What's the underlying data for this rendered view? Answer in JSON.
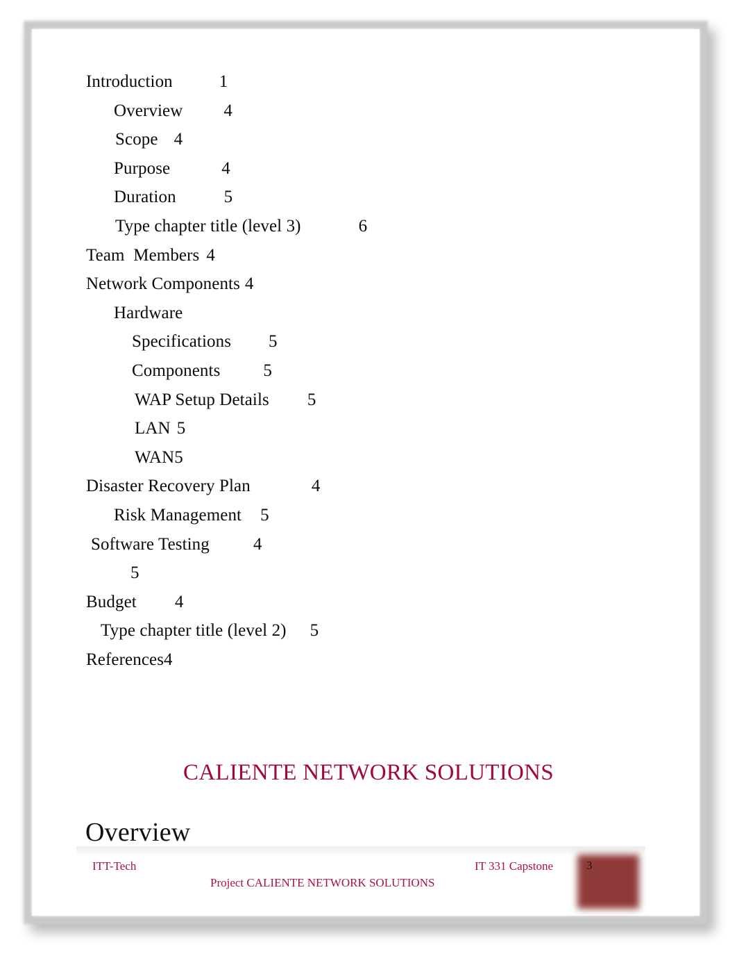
{
  "document": {
    "title": "CALIENTE NETWORK SOLUTIONS",
    "section_heading": "Overview"
  },
  "toc": {
    "entries": [
      {
        "title": "Introduction",
        "page": "1",
        "level": 0
      },
      {
        "title": "Overview",
        "page": "4",
        "level": 1
      },
      {
        "title": "Scope",
        "page": "4",
        "level": 1
      },
      {
        "title": "Purpose",
        "page": "4",
        "level": 1
      },
      {
        "title": "Duration",
        "page": "5",
        "level": 1
      },
      {
        "title": "Type chapter title (level 3)",
        "page": "6",
        "level": 1
      },
      {
        "title": "Team  Members",
        "page": "4",
        "level": 0
      },
      {
        "title": "Network Components",
        "page": "4",
        "level": 0
      },
      {
        "title": "Hardware",
        "page": "",
        "level": 1
      },
      {
        "title": "Specifications",
        "page": "5",
        "level": 2
      },
      {
        "title": "Components",
        "page": "5",
        "level": 2
      },
      {
        "title": "WAP Setup Details",
        "page": "5",
        "level": 2
      },
      {
        "title": "LAN",
        "page": "5",
        "level": 2
      },
      {
        "title": "WAN",
        "page": "5",
        "level": 2
      },
      {
        "title": "Disaster Recovery Plan",
        "page": "4",
        "level": 0
      },
      {
        "title": "Risk Management",
        "page": "5",
        "level": 1
      },
      {
        "title": "Software Testing",
        "page": "4",
        "level": 0
      },
      {
        "title": "",
        "page": "5",
        "level": 2
      },
      {
        "title": "Budget",
        "page": "4",
        "level": 0
      },
      {
        "title": "Type chapter title (level 2)",
        "page": "5",
        "level": 1
      },
      {
        "title": "References",
        "page": "4",
        "level": 0
      }
    ]
  },
  "footer": {
    "left": "ITT-Tech",
    "right": "IT 331 Capstone",
    "center": "Project CALIENTE NETWORK SOLUTIONS",
    "page_number": "3"
  },
  "colors": {
    "accent": "#a0083a",
    "footer_text": "#a8104a",
    "page_box": "#8e3a38",
    "body_text": "#0b0b0b"
  }
}
